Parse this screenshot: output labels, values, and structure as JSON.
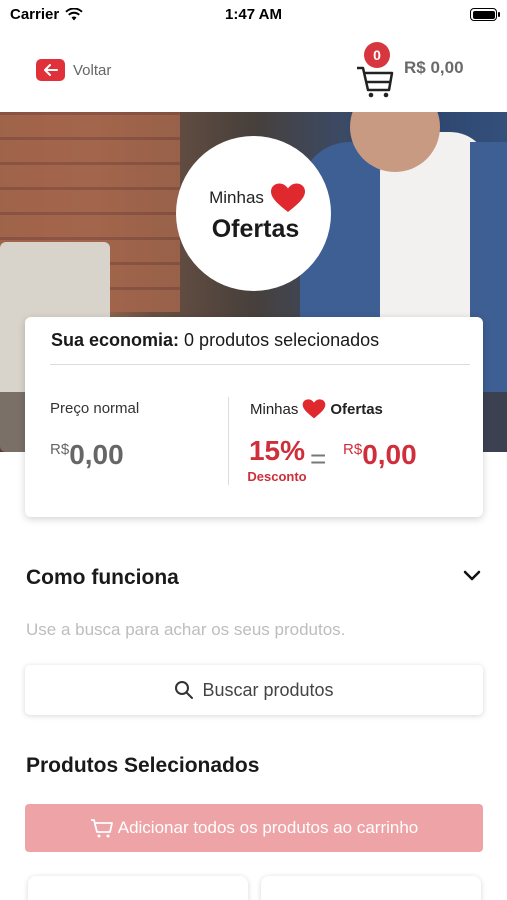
{
  "status_bar": {
    "carrier": "Carrier",
    "time": "1:47 AM"
  },
  "nav": {
    "back_label": "Voltar",
    "cart_count": "0",
    "cart_total": "R$ 0,00"
  },
  "brand": {
    "minhas": "Minhas",
    "ofertas": "Ofertas"
  },
  "economy": {
    "label": "Sua economia:",
    "summary": "0 produtos selecionados",
    "normal_label": "Preço normal",
    "normal_currency": "R$",
    "normal_amount": "0,00",
    "offer_brand_minhas": "Minhas",
    "offer_brand_ofertas": "Ofertas",
    "discount_percent": "15%",
    "discount_label": "Desconto",
    "equals": "=",
    "offer_currency": "R$",
    "offer_amount": "0,00"
  },
  "how_it_works": {
    "title": "Como funciona",
    "description": "Use a busca para achar os seus produtos."
  },
  "search": {
    "label": "Buscar produtos"
  },
  "selected": {
    "title": "Produtos Selecionados",
    "add_all_label": "Adicionar todos os produtos ao carrinho"
  },
  "colors": {
    "accent": "#cf2f3a",
    "button_disabled": "#eea3a7",
    "brand_red": "#e0313b"
  },
  "icons": [
    "wifi-icon",
    "battery-icon",
    "back-arrow-icon",
    "cart-icon",
    "heart-icon",
    "chevron-down-icon",
    "search-icon"
  ]
}
